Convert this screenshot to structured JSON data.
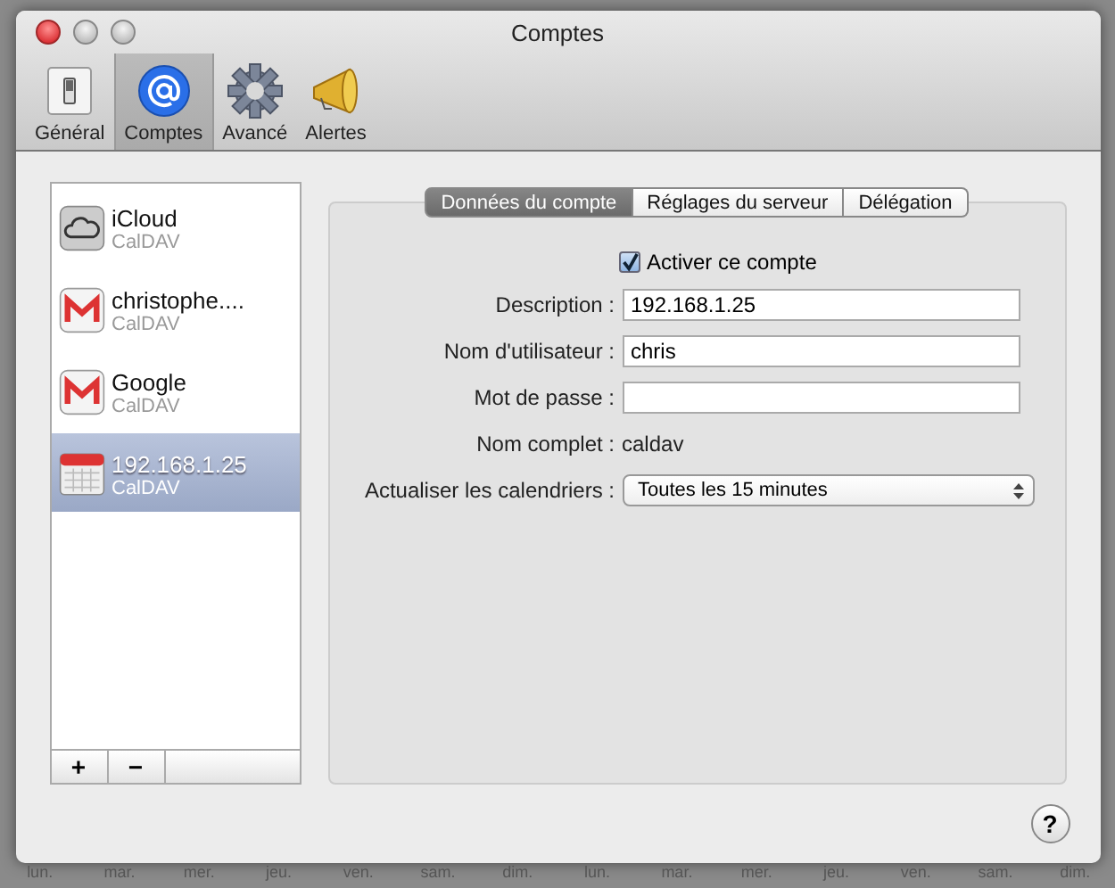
{
  "window": {
    "title": "Comptes"
  },
  "toolbar": [
    {
      "label": "Général",
      "kind": "switch",
      "selected": false
    },
    {
      "label": "Comptes",
      "kind": "at",
      "selected": true
    },
    {
      "label": "Avancé",
      "kind": "gear",
      "selected": false
    },
    {
      "label": "Alertes",
      "kind": "horn",
      "selected": false
    }
  ],
  "accounts": [
    {
      "name": "iCloud",
      "type": "CalDAV",
      "kind": "cloud",
      "selected": false
    },
    {
      "name": "christophe....",
      "type": "CalDAV",
      "kind": "mail",
      "selected": false
    },
    {
      "name": "Google",
      "type": "CalDAV",
      "kind": "mail",
      "selected": false
    },
    {
      "name": "192.168.1.25",
      "type": "CalDAV",
      "kind": "calendar",
      "selected": true
    }
  ],
  "list_buttons": [
    "+",
    "−"
  ],
  "tabs": [
    {
      "label": "Données du compte",
      "selected": true
    },
    {
      "label": "Réglages du serveur",
      "selected": false
    },
    {
      "label": "Délégation",
      "selected": false
    }
  ],
  "enable": {
    "label": "Activer ce compte",
    "checked": true
  },
  "fields": [
    {
      "label": "Description :",
      "kind": "text",
      "value": "192.168.1.25"
    },
    {
      "label": "Nom d'utilisateur :",
      "kind": "text",
      "value": "chris"
    },
    {
      "label": "Mot de passe :",
      "kind": "password"
    },
    {
      "label": "Nom complet :",
      "kind": "static",
      "value": "caldav"
    },
    {
      "label": "Actualiser les calendriers :",
      "kind": "select",
      "value": "Toutes les 15 minutes"
    }
  ],
  "help": "?",
  "background_days": [
    "lun.",
    "mar.",
    "mer.",
    "jeu.",
    "ven.",
    "sam.",
    "dim.",
    "lun.",
    "mar.",
    "mer.",
    "jeu.",
    "ven.",
    "sam.",
    "dim."
  ]
}
